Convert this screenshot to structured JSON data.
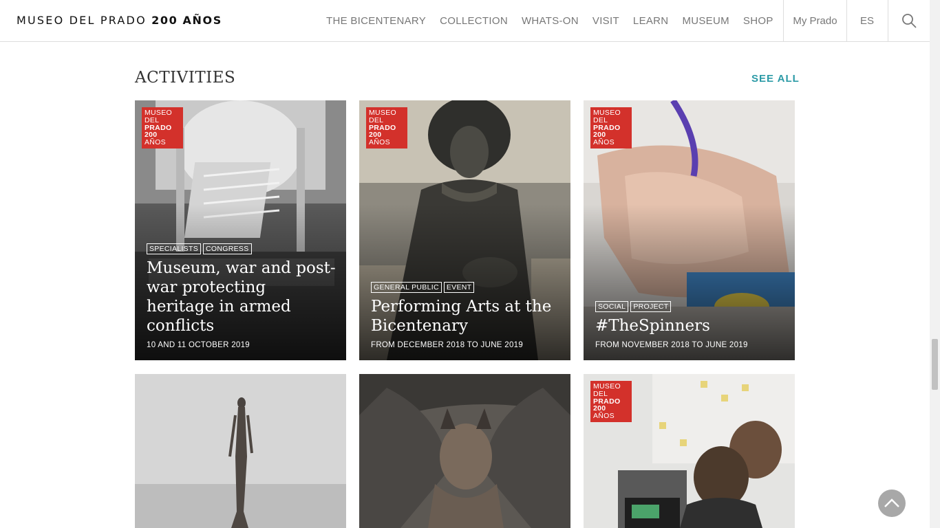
{
  "header": {
    "logo_text": "MUSEO DEL PRADO",
    "logo_bold": "200 AÑOS",
    "nav": [
      "THE BICENTENARY",
      "COLLECTION",
      "WHATS-ON",
      "VISIT",
      "LEARN",
      "MUSEUM",
      "SHOP"
    ],
    "my_prado": "My Prado",
    "language": "ES",
    "search_icon": "search-icon"
  },
  "section": {
    "title": "ACTIVITIES",
    "see_all": "SEE ALL"
  },
  "badge": {
    "line1": "MUSEO",
    "line2": "DEL",
    "line3": "PRADO",
    "line4": "200",
    "line5": "AÑOS"
  },
  "cards": [
    {
      "tags": [
        "SPECIALISTS",
        "CONGRESS"
      ],
      "title": "Museum, war and post-war protecting heritage in armed conflicts",
      "date": "10 AND 11 OCTOBER 2019"
    },
    {
      "tags": [
        "GENERAL PUBLIC",
        "EVENT"
      ],
      "title": "Performing Arts at the Bicentenary",
      "date": "FROM DECEMBER 2018 TO JUNE 2019"
    },
    {
      "tags": [
        "SOCIAL",
        "PROJECT"
      ],
      "title": "#TheSpinners",
      "date": "FROM NOVEMBER 2018 TO JUNE 2019"
    }
  ],
  "colors": {
    "accent": "#2b9aa6",
    "badge": "#d3312b"
  }
}
